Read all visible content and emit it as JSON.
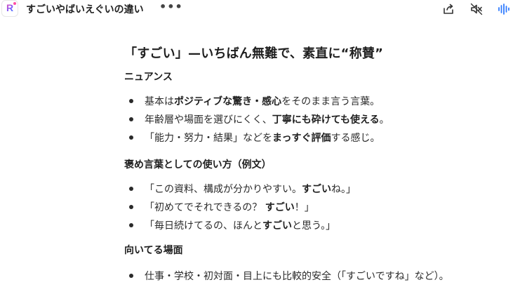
{
  "app": {
    "logo_letter": "R"
  },
  "header": {
    "title": "すごいやばいえぐいの違い",
    "more_label": "•••"
  },
  "article": {
    "heading": "「すごい」—いちばん無難で、素直に“称賛”",
    "section1": {
      "title": "ニュアンス",
      "items": [
        {
          "a": "基本は",
          "b": "ポジティブな驚き・感心",
          "c": "をそのまま言う言葉。"
        },
        {
          "a": "年齢層や場面を選びにくく、",
          "b": "丁寧にも砕けても使える",
          "c": "。"
        },
        {
          "a": "「能力・努力・結果」などを",
          "b": "まっすぐ評価",
          "c": "する感じ。"
        }
      ]
    },
    "section2": {
      "title": "褒め言葉としての使い方（例文）",
      "items": [
        {
          "a": "「この資料、構成が分かりやすい。",
          "b": "すごい",
          "c": "ね。」"
        },
        {
          "a": "「初めてでそれできるの？ ",
          "b": "すごい",
          "c": "！」"
        },
        {
          "a": "「毎日続けてるの、ほんと",
          "b": "すごい",
          "c": "と思う。」"
        }
      ]
    },
    "section3": {
      "title": "向いてる場面",
      "items": [
        {
          "a": "仕事・学校・初対面・目上にも比較的安全（「すごいですね」など）。",
          "b": "",
          "c": ""
        }
      ]
    }
  },
  "icons": {
    "share": "share-icon",
    "mute": "speaker-mute-icon",
    "voice": "voice-waveform-icon",
    "voice_color": "#2f7bff"
  }
}
